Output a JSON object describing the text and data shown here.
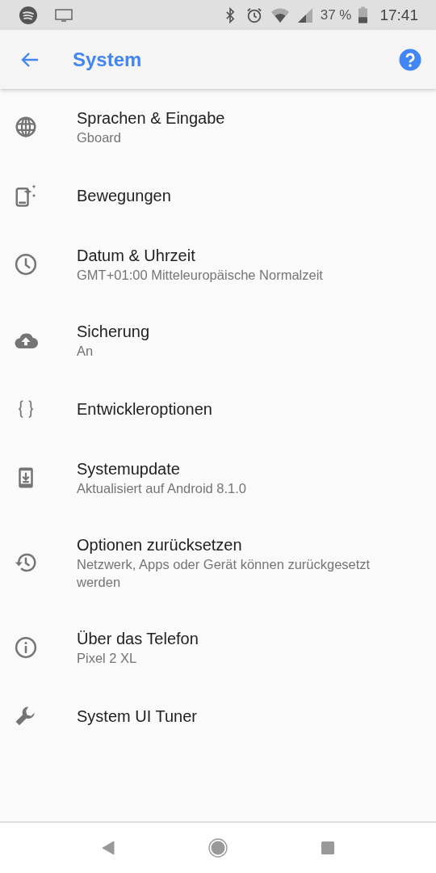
{
  "status_bar": {
    "battery": "37 %",
    "time": "17:41"
  },
  "toolbar": {
    "title": "System"
  },
  "items": [
    {
      "title": "Sprachen & Eingabe",
      "summary": "Gboard"
    },
    {
      "title": "Bewegungen"
    },
    {
      "title": "Datum & Uhrzeit",
      "summary": "GMT+01:00 Mitteleuropäische Normalzeit"
    },
    {
      "title": "Sicherung",
      "summary": "An"
    },
    {
      "title": "Entwickleroptionen"
    },
    {
      "title": "Systemupdate",
      "summary": "Aktualisiert auf Android 8.1.0"
    },
    {
      "title": "Optionen zurücksetzen",
      "summary": "Netzwerk, Apps oder Gerät können zurückgesetzt werden"
    },
    {
      "title": "Über das Telefon",
      "summary": "Pixel 2 XL"
    },
    {
      "title": "System UI Tuner"
    }
  ]
}
